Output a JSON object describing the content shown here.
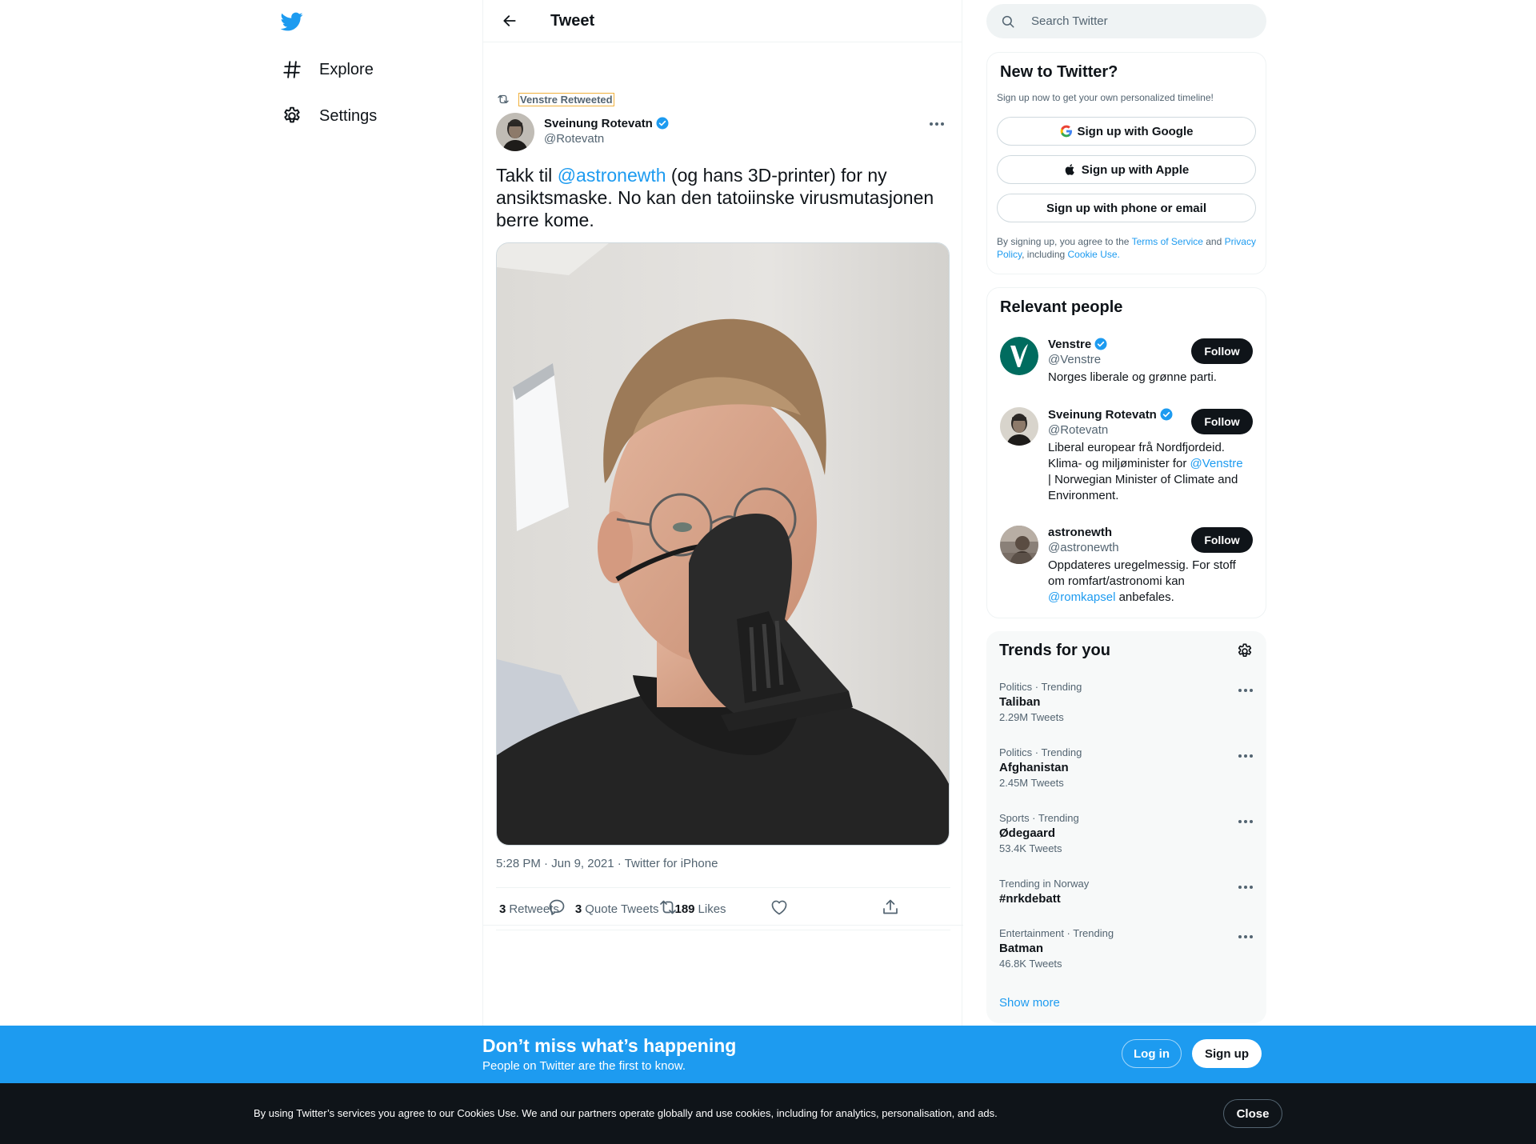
{
  "colors": {
    "accent": "#1d9bf0",
    "text": "#0f1419",
    "muted": "#536471",
    "border": "#eff3f4",
    "banner": "#1d9bf0",
    "cookie_bg": "#0f1419"
  },
  "nav": {
    "logo_icon": "twitter-bird-icon",
    "items": [
      {
        "label": "Explore",
        "icon": "hashtag-icon"
      },
      {
        "label": "Settings",
        "icon": "gear-icon"
      }
    ]
  },
  "header": {
    "title": "Tweet",
    "back_icon": "arrow-left-icon"
  },
  "tweet": {
    "retweeted_by": "Venstre Retweeted",
    "author_name": "Sveinung Rotevatn",
    "author_handle": "@Rotevatn",
    "text_before": "Takk til ",
    "text_mention": "@astronewth",
    "text_after": " (og hans 3D-printer) for ny ansiktsmaske. No kan den tatoiinske virusmutasjonen berre kome.",
    "time": "5:28 PM",
    "date": "Jun 9, 2021",
    "source": "Twitter for iPhone",
    "stats": {
      "retweets_count": "3",
      "retweets_label": "Retweets",
      "quotes_count": "3",
      "quotes_label": "Quote Tweets",
      "likes_count": "189",
      "likes_label": "Likes"
    }
  },
  "search": {
    "placeholder": "Search Twitter"
  },
  "signup": {
    "title": "New to Twitter?",
    "subtitle": "Sign up now to get your own personalized timeline!",
    "google": "Sign up with Google",
    "apple": "Sign up with Apple",
    "phone": "Sign up with phone or email",
    "legal_1": "By signing up, you agree to the ",
    "terms": "Terms of Service",
    "legal_2": " and ",
    "privacy": "Privacy Policy",
    "legal_3": ", including ",
    "cookie": "Cookie Use."
  },
  "people": {
    "title": "Relevant people",
    "follow_label": "Follow",
    "list": [
      {
        "name": "Venstre",
        "handle": "@Venstre",
        "bio": "Norges liberale og grønne parti."
      },
      {
        "name": "Sveinung Rotevatn",
        "handle": "@Rotevatn",
        "bio_1": "Liberal europear frå Nordfjordeid. Klima- og miljøminister for ",
        "bio_mention": "@Venstre",
        "bio_2": " | Norwegian Minister of Climate and Environment."
      },
      {
        "name": "astronewth",
        "handle": "@astronewth",
        "bio_1": "Oppdateres uregelmessig. For stoff om romfart/astronomi kan ",
        "bio_mention": "@romkapsel",
        "bio_2": " anbefales."
      }
    ]
  },
  "trends": {
    "title": "Trends for you",
    "items": [
      {
        "meta": "Politics · Trending",
        "name": "Taliban",
        "count": "2.29M Tweets"
      },
      {
        "meta": "Politics · Trending",
        "name": "Afghanistan",
        "count": "2.45M Tweets"
      },
      {
        "meta": "Sports · Trending",
        "name": "Ødegaard",
        "count": "53.4K Tweets"
      },
      {
        "meta": "Trending in Norway",
        "name": "#nrkdebatt",
        "count": ""
      },
      {
        "meta": "Entertainment · Trending",
        "name": "Batman",
        "count": "46.8K Tweets"
      }
    ],
    "show_more": "Show more"
  },
  "banner": {
    "title": "Don’t miss what’s happening",
    "subtitle": "People on Twitter are the first to know.",
    "login": "Log in",
    "signup": "Sign up"
  },
  "cookie": {
    "text": "By using Twitter’s services you agree to our Cookies Use. We and our partners operate globally and use cookies, including for analytics, personalisation, and ads.",
    "close": "Close"
  }
}
